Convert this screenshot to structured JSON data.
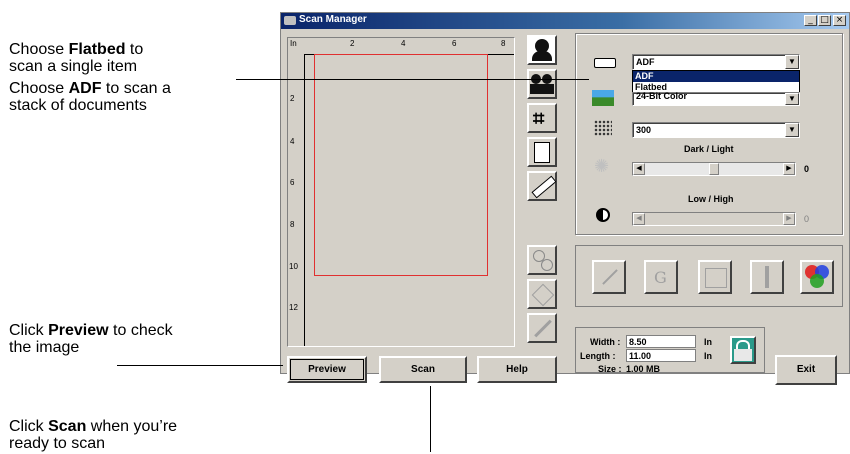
{
  "callouts": {
    "flatbed": {
      "pre": "Choose ",
      "bold": "Flatbed",
      "post": " to",
      "line2": "scan a single item"
    },
    "adf": {
      "pre": "Choose ",
      "bold": "ADF",
      "post": " to scan a",
      "line2": "stack of documents"
    },
    "preview": {
      "pre": "Click ",
      "bold": "Preview",
      "post": " to check",
      "line2": "the image"
    },
    "scan": {
      "pre": "Click ",
      "bold": "Scan",
      "post": " when you’re",
      "line2": "ready to scan"
    }
  },
  "window": {
    "title": "Scan Manager",
    "controls": {
      "minimize": "_",
      "maximize": "□",
      "close": "×"
    }
  },
  "ruler": {
    "unit": "In",
    "top_ticks": [
      "2",
      "4",
      "6",
      "8"
    ],
    "left_ticks": [
      "2",
      "4",
      "6",
      "8",
      "10",
      "12"
    ]
  },
  "settings": {
    "source": {
      "value": "ADF",
      "options": [
        "ADF",
        "Flatbed"
      ],
      "highlighted": "ADF"
    },
    "color_mode": {
      "value": "24-Bit Color"
    },
    "resolution": {
      "value": "300"
    },
    "dark_light": {
      "label": "Dark / Light",
      "value": "0"
    },
    "low_high": {
      "label": "Low / High",
      "value": "0"
    }
  },
  "size": {
    "width_label": "Width :",
    "width_value": "8.50",
    "length_label": "Length :",
    "length_value": "11.00",
    "unit": "In",
    "size_label": "Size :",
    "size_value": "1.00  MB"
  },
  "buttons": {
    "preview": "Preview",
    "scan": "Scan",
    "help": "Help",
    "exit": "Exit"
  },
  "colors": {
    "selection": "#0a246a",
    "preview_frame": "#e03030"
  }
}
